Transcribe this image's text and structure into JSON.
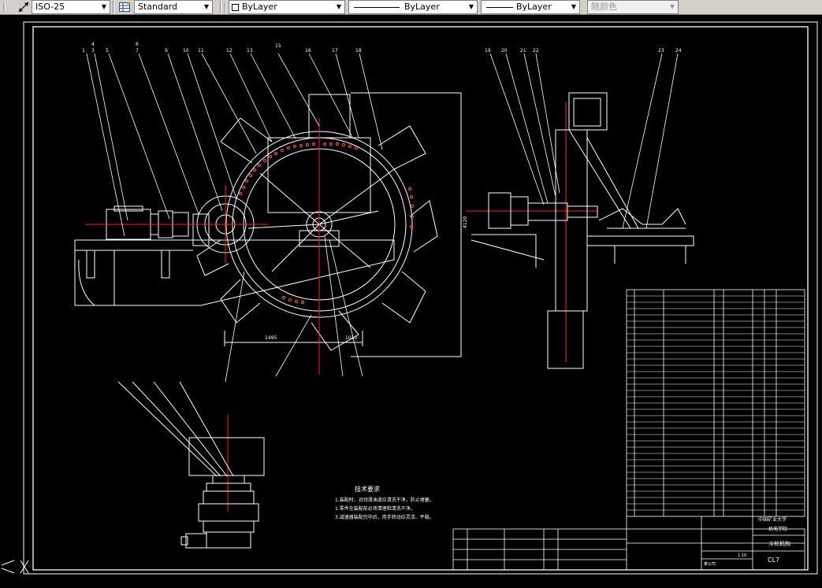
{
  "toolbar": {
    "dimstyle": {
      "value": "ISO-25",
      "icon": "dimension-style-icon"
    },
    "tablestyle": {
      "value": "Standard",
      "icon": "table-style-icon"
    },
    "layer_color": {
      "value": "ByLayer"
    },
    "linetype": {
      "value": "ByLayer"
    },
    "lineweight": {
      "value": "ByLayer"
    },
    "plotstyle": {
      "value": "随颜色"
    }
  },
  "drawing": {
    "dimensions": {
      "d1": "1495",
      "d2": "1010",
      "d3": "4120"
    },
    "notes": {
      "heading": "技术要求",
      "lines": [
        "1.装配时，对润滑油道应清洗干净，防止堵塞。",
        "1.零件在装配前必须清理和清洗干净。",
        "3.减速器装配完毕后，用手转动应灵活、平稳。"
      ]
    },
    "title_block": {
      "university": "中国矿业大学",
      "department": "机电学院",
      "drawing_name": "斗轮机构",
      "drawing_no": "CL7",
      "scale": "1:10",
      "company": "某公司"
    }
  }
}
